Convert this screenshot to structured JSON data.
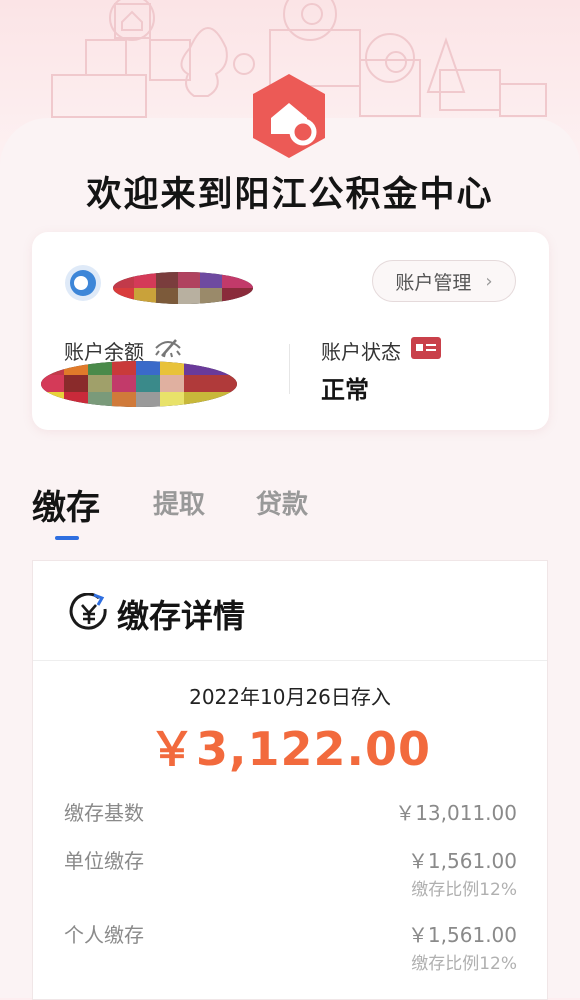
{
  "welcome_title": "欢迎来到阳江公积金中心",
  "account": {
    "manage_button": "账户管理",
    "chevron": "›",
    "balance_label": "账户余额",
    "status_label": "账户状态",
    "status_value": "正常"
  },
  "tabs": [
    {
      "label": "缴存",
      "active": true
    },
    {
      "label": "提取",
      "active": false
    },
    {
      "label": "贷款",
      "active": false
    }
  ],
  "detail": {
    "title": "缴存详情",
    "date_line": "2022年10月26日存入",
    "amount": "￥3,122.00",
    "rows": [
      {
        "label": "缴存基数",
        "value": "￥13,011.00",
        "sub": ""
      },
      {
        "label": "单位缴存",
        "value": "￥1,561.00",
        "sub": "缴存比例12%"
      },
      {
        "label": "个人缴存",
        "value": "￥1,561.00",
        "sub": "缴存比例12%"
      }
    ]
  },
  "colors": {
    "accent": "#f26a3d",
    "brand_red": "#ec5a56",
    "tab_underline": "#2f6fe0",
    "background": "#fbf3f4"
  },
  "icons": {
    "logo": "house-logo-icon",
    "avatar": "avatar-icon",
    "hide": "eye-hidden-icon",
    "status": "id-card-icon",
    "detail": "yuan-refresh-icon"
  }
}
